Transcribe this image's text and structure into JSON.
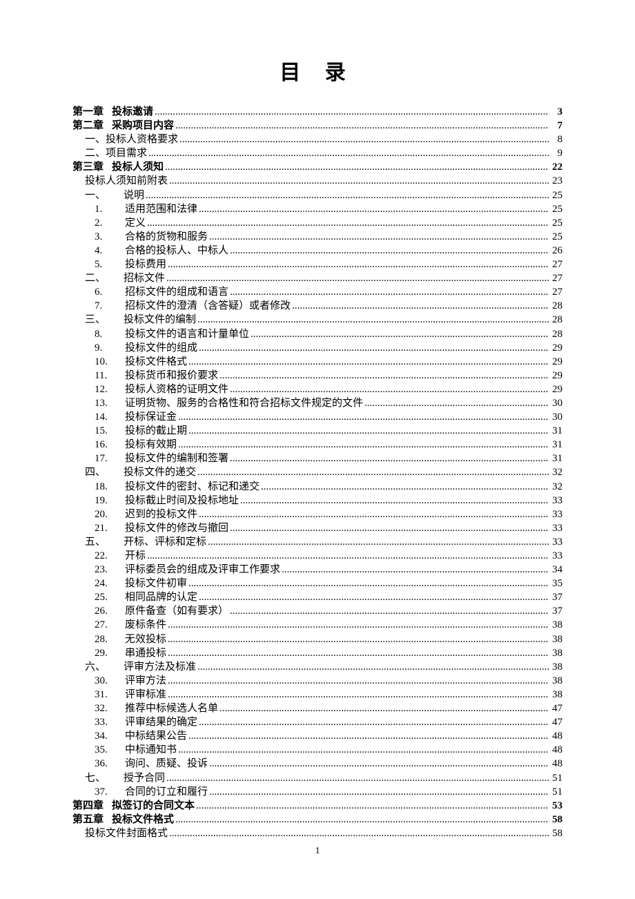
{
  "title": "目 录",
  "footer": "1",
  "toc": [
    {
      "level": 0,
      "bold": true,
      "num": "第一章",
      "text": "投标邀请",
      "page": "3"
    },
    {
      "level": 0,
      "bold": true,
      "num": "第二章",
      "text": "采购项目内容",
      "page": "7"
    },
    {
      "level": 1,
      "bold": false,
      "num": "",
      "text": "一、投标人资格要求",
      "page": "8"
    },
    {
      "level": 1,
      "bold": false,
      "num": "",
      "text": "二、项目需求",
      "page": "9"
    },
    {
      "level": 0,
      "bold": true,
      "num": "第三章",
      "text": "投标人须知",
      "page": "22"
    },
    {
      "level": 1,
      "bold": false,
      "num": "",
      "text": "投标人须知前附表",
      "page": "23"
    },
    {
      "level": 2,
      "bold": false,
      "num": "一、",
      "text": "说明",
      "page": "25"
    },
    {
      "level": 3,
      "bold": false,
      "num": "1.",
      "text": "适用范围和法律",
      "page": "25"
    },
    {
      "level": 3,
      "bold": false,
      "num": "2.",
      "text": "定义",
      "page": "25"
    },
    {
      "level": 3,
      "bold": false,
      "num": "3.",
      "text": "合格的货物和服务",
      "page": "25"
    },
    {
      "level": 3,
      "bold": false,
      "num": "4.",
      "text": "合格的投标人、中标人",
      "page": "26"
    },
    {
      "level": 3,
      "bold": false,
      "num": "5.",
      "text": "投标费用",
      "page": "27"
    },
    {
      "level": 2,
      "bold": false,
      "num": "二、",
      "text": "招标文件",
      "page": "27"
    },
    {
      "level": 3,
      "bold": false,
      "num": "6.",
      "text": "招标文件的组成和语言",
      "page": "27"
    },
    {
      "level": 3,
      "bold": false,
      "num": "7.",
      "text": "招标文件的澄清（含答疑）或者修改",
      "page": "28"
    },
    {
      "level": 2,
      "bold": false,
      "num": "三、",
      "text": "投标文件的编制",
      "page": "28"
    },
    {
      "level": 3,
      "bold": false,
      "num": "8.",
      "text": "投标文件的语言和计量单位",
      "page": "28"
    },
    {
      "level": 3,
      "bold": false,
      "num": "9.",
      "text": "投标文件的组成",
      "page": "29"
    },
    {
      "level": 3,
      "bold": false,
      "num": "10.",
      "text": "投标文件格式",
      "page": "29"
    },
    {
      "level": 3,
      "bold": false,
      "num": "11.",
      "text": "投标货币和报价要求",
      "page": "29"
    },
    {
      "level": 3,
      "bold": false,
      "num": "12.",
      "text": "投标人资格的证明文件",
      "page": "29"
    },
    {
      "level": 3,
      "bold": false,
      "num": "13.",
      "text": "证明货物、服务的合格性和符合招标文件规定的文件",
      "page": "30"
    },
    {
      "level": 3,
      "bold": false,
      "num": "14.",
      "text": "投标保证金",
      "page": "30"
    },
    {
      "level": 3,
      "bold": false,
      "num": "15.",
      "text": "投标的截止期",
      "page": "31"
    },
    {
      "level": 3,
      "bold": false,
      "num": "16.",
      "text": "投标有效期",
      "page": "31"
    },
    {
      "level": 3,
      "bold": false,
      "num": "17.",
      "text": "投标文件的编制和签署",
      "page": "31"
    },
    {
      "level": 2,
      "bold": false,
      "num": "四、",
      "text": "投标文件的递交",
      "page": "32"
    },
    {
      "level": 3,
      "bold": false,
      "num": "18.",
      "text": "投标文件的密封、标记和递交",
      "page": "32"
    },
    {
      "level": 3,
      "bold": false,
      "num": "19.",
      "text": "投标截止时间及投标地址",
      "page": "33"
    },
    {
      "level": 3,
      "bold": false,
      "num": "20.",
      "text": "迟到的投标文件",
      "page": "33"
    },
    {
      "level": 3,
      "bold": false,
      "num": "21.",
      "text": "投标文件的修改与撤回",
      "page": "33"
    },
    {
      "level": 2,
      "bold": false,
      "num": "五、",
      "text": "开标、评标和定标",
      "page": "33"
    },
    {
      "level": 3,
      "bold": false,
      "num": "22.",
      "text": "开标",
      "page": "33"
    },
    {
      "level": 3,
      "bold": false,
      "num": "23.",
      "text": "评标委员会的组成及评审工作要求",
      "page": "34"
    },
    {
      "level": 3,
      "bold": false,
      "num": "24.",
      "text": "投标文件初审",
      "page": "35"
    },
    {
      "level": 3,
      "bold": false,
      "num": "25.",
      "text": "相同品牌的认定",
      "page": "37"
    },
    {
      "level": 3,
      "bold": false,
      "num": "26.",
      "text": "原件备查（如有要求）",
      "page": "37"
    },
    {
      "level": 3,
      "bold": false,
      "num": "27.",
      "text": "废标条件",
      "page": "38"
    },
    {
      "level": 3,
      "bold": false,
      "num": "28.",
      "text": "无效投标",
      "page": "38"
    },
    {
      "level": 3,
      "bold": false,
      "num": "29.",
      "text": "串通投标",
      "page": "38"
    },
    {
      "level": 2,
      "bold": false,
      "num": "六、",
      "text": "评审方法及标准",
      "page": "38"
    },
    {
      "level": 3,
      "bold": false,
      "num": "30.",
      "text": "评审方法",
      "page": "38"
    },
    {
      "level": 3,
      "bold": false,
      "num": "31.",
      "text": "评审标准",
      "page": "38"
    },
    {
      "level": 3,
      "bold": false,
      "num": "32.",
      "text": "推荐中标候选人名单",
      "page": "47"
    },
    {
      "level": 3,
      "bold": false,
      "num": "33.",
      "text": "评审结果的确定",
      "page": "47"
    },
    {
      "level": 3,
      "bold": false,
      "num": "34.",
      "text": "中标结果公告",
      "page": "48"
    },
    {
      "level": 3,
      "bold": false,
      "num": "35.",
      "text": "中标通知书",
      "page": "48"
    },
    {
      "level": 3,
      "bold": false,
      "num": "36.",
      "text": "询问、质疑、投诉",
      "page": "48"
    },
    {
      "level": 2,
      "bold": false,
      "num": "七、",
      "text": "授予合同",
      "page": "51"
    },
    {
      "level": 3,
      "bold": false,
      "num": "37.",
      "text": "合同的订立和履行",
      "page": "51"
    },
    {
      "level": 0,
      "bold": true,
      "num": "第四章",
      "text": "拟签订的合同文本",
      "page": "53"
    },
    {
      "level": 0,
      "bold": true,
      "num": "第五章",
      "text": "投标文件格式",
      "page": "58"
    },
    {
      "level": 1,
      "bold": false,
      "num": "",
      "text": "投标文件封面格式",
      "page": "58"
    }
  ]
}
